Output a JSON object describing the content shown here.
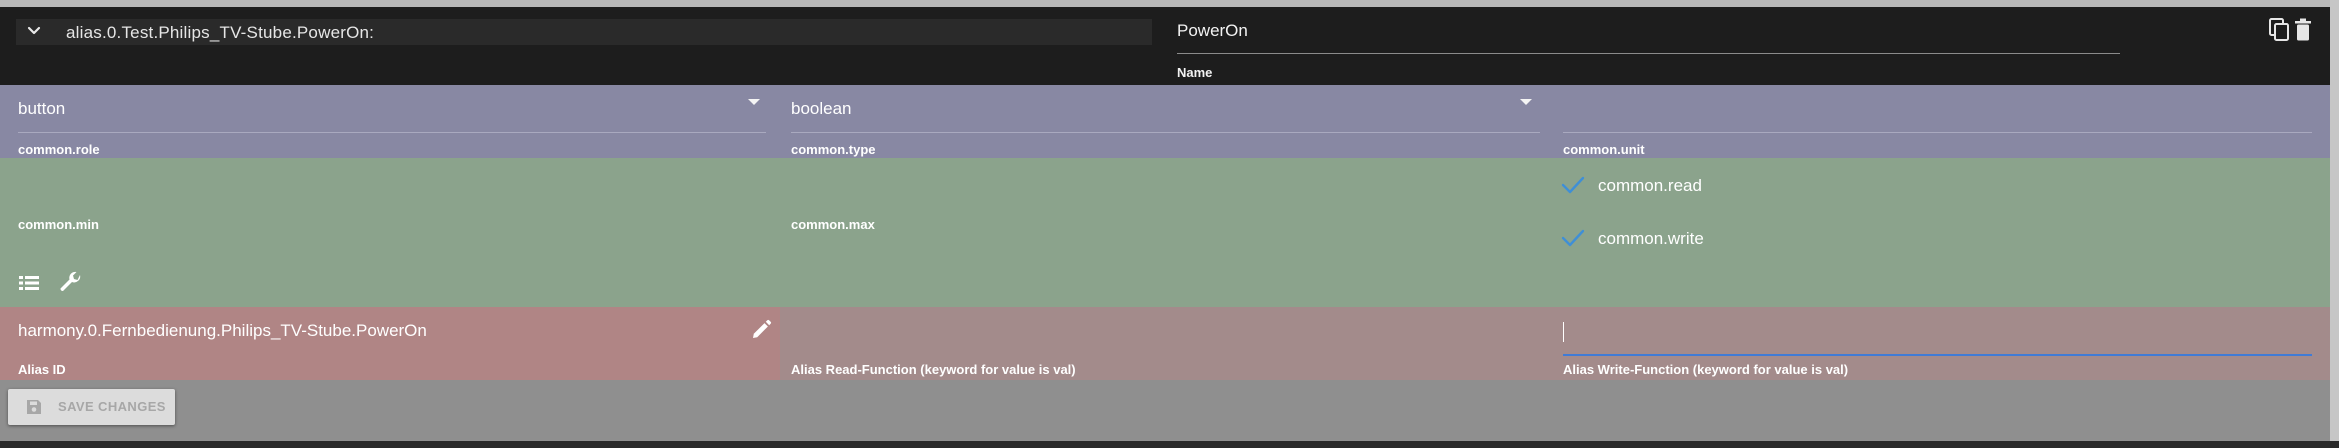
{
  "header": {
    "object_id": "alias.0.Test.Philips_TV-Stube.PowerOn:",
    "name_value": "PowerOn",
    "name_label": "Name"
  },
  "common": {
    "role": {
      "value": "button",
      "label": "common.role"
    },
    "type": {
      "value": "boolean",
      "label": "common.type"
    },
    "unit": {
      "value": "",
      "label": "common.unit"
    },
    "min": {
      "label": "common.min"
    },
    "max": {
      "label": "common.max"
    },
    "read": {
      "label": "common.read",
      "checked": true
    },
    "write": {
      "label": "common.write",
      "checked": true
    }
  },
  "alias": {
    "id": {
      "value": "harmony.0.Fernbedienung.Philips_TV-Stube.PowerOn",
      "label": "Alias ID"
    },
    "read_function": {
      "value": "",
      "label": "Alias Read-Function (keyword for value is val)"
    },
    "write_function": {
      "value": "",
      "label": "Alias Write-Function (keyword for value is val)"
    }
  },
  "actions": {
    "save_label": "SAVE CHANGES"
  },
  "icons": {
    "expand": "chevron-down-icon",
    "copy": "copy-icon",
    "delete": "trash-icon",
    "list": "list-icon",
    "settings": "wrench-icon",
    "edit": "pencil-icon",
    "save": "save-icon",
    "check": "check-icon"
  },
  "colors": {
    "header_bg": "#1d1d1d",
    "common_row": "#8888a3",
    "range_row": "#8ba38c",
    "alias_row": "#a38b8b",
    "check": "#3f8fd6",
    "focus": "#3f7bd6"
  }
}
